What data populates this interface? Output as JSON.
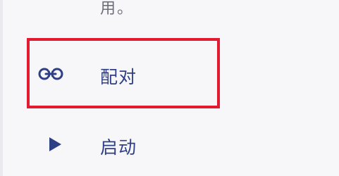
{
  "description": {
    "tail_text": "用。"
  },
  "menu": {
    "items": [
      {
        "label": "配对",
        "icon": "link-icon"
      },
      {
        "label": "启动",
        "icon": "play-icon"
      }
    ]
  },
  "colors": {
    "accent": "#2f3f86",
    "highlight": "#e21b32",
    "background": "#f7f7f9",
    "secondary_text": "#6b6f78"
  }
}
